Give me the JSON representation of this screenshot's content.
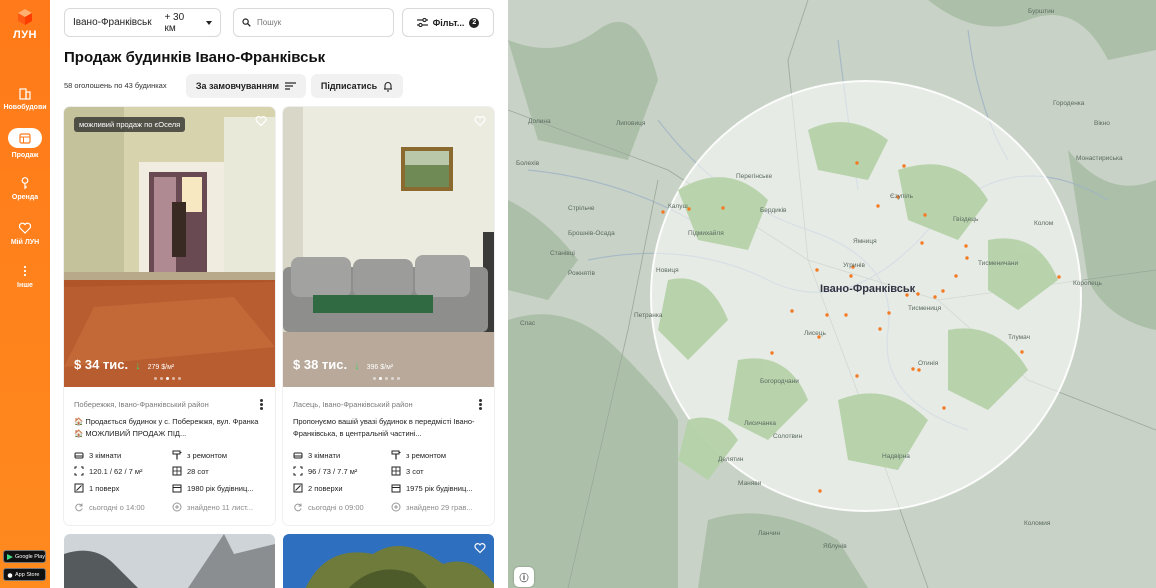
{
  "sidebar": {
    "logo_text": "ЛУН",
    "items": [
      {
        "label": "Новобудови",
        "icon": "building-icon"
      },
      {
        "label": "Продаж",
        "icon": "house-sale-icon",
        "active": true
      },
      {
        "label": "Оренда",
        "icon": "key-icon"
      },
      {
        "label": "Мій ЛУН",
        "icon": "heart-icon"
      },
      {
        "label": "Інше",
        "icon": "more-icon"
      }
    ],
    "stores": [
      "Google Play",
      "App Store"
    ]
  },
  "filters": {
    "city": "Івано-Франківськ",
    "radius": "+ 30 км",
    "search_placeholder": "Пошук",
    "filter_label": "Фільт...",
    "filter_count": "2"
  },
  "header": {
    "title": "Продаж будинків Івано-Франківськ",
    "count_text": "58 оголошень по 43 будинках",
    "sort_label": "За замовчуванням",
    "subscribe_label": "Підписатись"
  },
  "listings": [
    {
      "price": "$ 34 тис.",
      "price_per_m2": "279 $/м²",
      "tag": "можливий продаж по єОселя",
      "locality": "Побережжя, Івано-Франківський район",
      "description": "🏠 Продається будинок у с. Побережжя, вул. Франка 🏠 МОЖЛИВИЙ ПРОДАЖ ПІД...",
      "rooms": "3 кімнати",
      "condition": "з ремонтом",
      "area": "120.1 / 62 / 7 м²",
      "land": "28 сот",
      "floors": "1 поверх",
      "year": "1980 рік будівниц...",
      "updated": "сьогодні о 14:00",
      "found": "знайдено 11 лист..."
    },
    {
      "price": "$ 38 тис.",
      "price_per_m2": "396 $/м²",
      "tag": "",
      "locality": "Ласець, Івано-Франківський район",
      "description": "Пропонуємо вашій увазі будинок в передмісті Івано-Франківська, в центральній частині...",
      "rooms": "3 кімнати",
      "condition": "з ремонтом",
      "area": "96 / 73 / 7.7 м²",
      "land": "3 сот",
      "floors": "2 поверхи",
      "year": "1975 рік будівниц...",
      "updated": "сьогодні о 09:00",
      "found": "знайдено 29 грав..."
    }
  ],
  "map": {
    "city_label": "Івано-Франківськ",
    "places": [
      "Бурштин",
      "Калуш",
      "Перегінське",
      "Новиця",
      "Петранка",
      "Стрільче",
      "Станівці",
      "Рожнятів",
      "Долина",
      "Болехів",
      "Брошнів-Осада",
      "Спас",
      "Липовиця",
      "Підмихайля",
      "Бердиків",
      "Єзупіль",
      "Тисмениця",
      "Ямниця",
      "Угринів",
      "Лисець",
      "Богородчани",
      "Солотвин",
      "Маняви",
      "Надвірна",
      "Лисичанка",
      "Колом",
      "Гвіздець",
      "Отинія",
      "Тлумач",
      "Городенка",
      "Монастириська",
      "Коропець",
      "Вікно",
      "Тисменичани",
      "Делятин",
      "Ланчин",
      "Яблунів",
      "Коломия"
    ],
    "info_icon": "info-icon"
  },
  "colors": {
    "brand": "#ff7a1a",
    "accent_green": "#4ccf6a",
    "map_pin": "#f47a24"
  }
}
